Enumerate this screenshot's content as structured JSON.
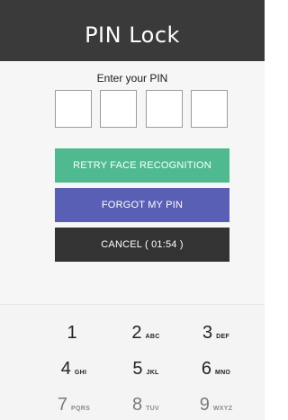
{
  "header": {
    "title": "PIN Lock"
  },
  "prompt": {
    "text": "Enter your PIN"
  },
  "buttons": {
    "retry_face": {
      "label": "RETRY FACE RECOGNITION",
      "color": "#4fba8f"
    },
    "forgot_pin": {
      "label": "FORGOT MY PIN",
      "color": "#5a5fb6"
    },
    "cancel": {
      "label": "CANCEL ( 01:54 )",
      "color": "#333333"
    }
  },
  "keypad": {
    "keys": [
      {
        "digit": "1",
        "letters": ""
      },
      {
        "digit": "2",
        "letters": "ABC"
      },
      {
        "digit": "3",
        "letters": "DEF"
      },
      {
        "digit": "4",
        "letters": "GHI"
      },
      {
        "digit": "5",
        "letters": "JKL"
      },
      {
        "digit": "6",
        "letters": "MNO"
      },
      {
        "digit": "7",
        "letters": "PQRS"
      },
      {
        "digit": "8",
        "letters": "TUV"
      },
      {
        "digit": "9",
        "letters": "WXYZ"
      }
    ]
  }
}
